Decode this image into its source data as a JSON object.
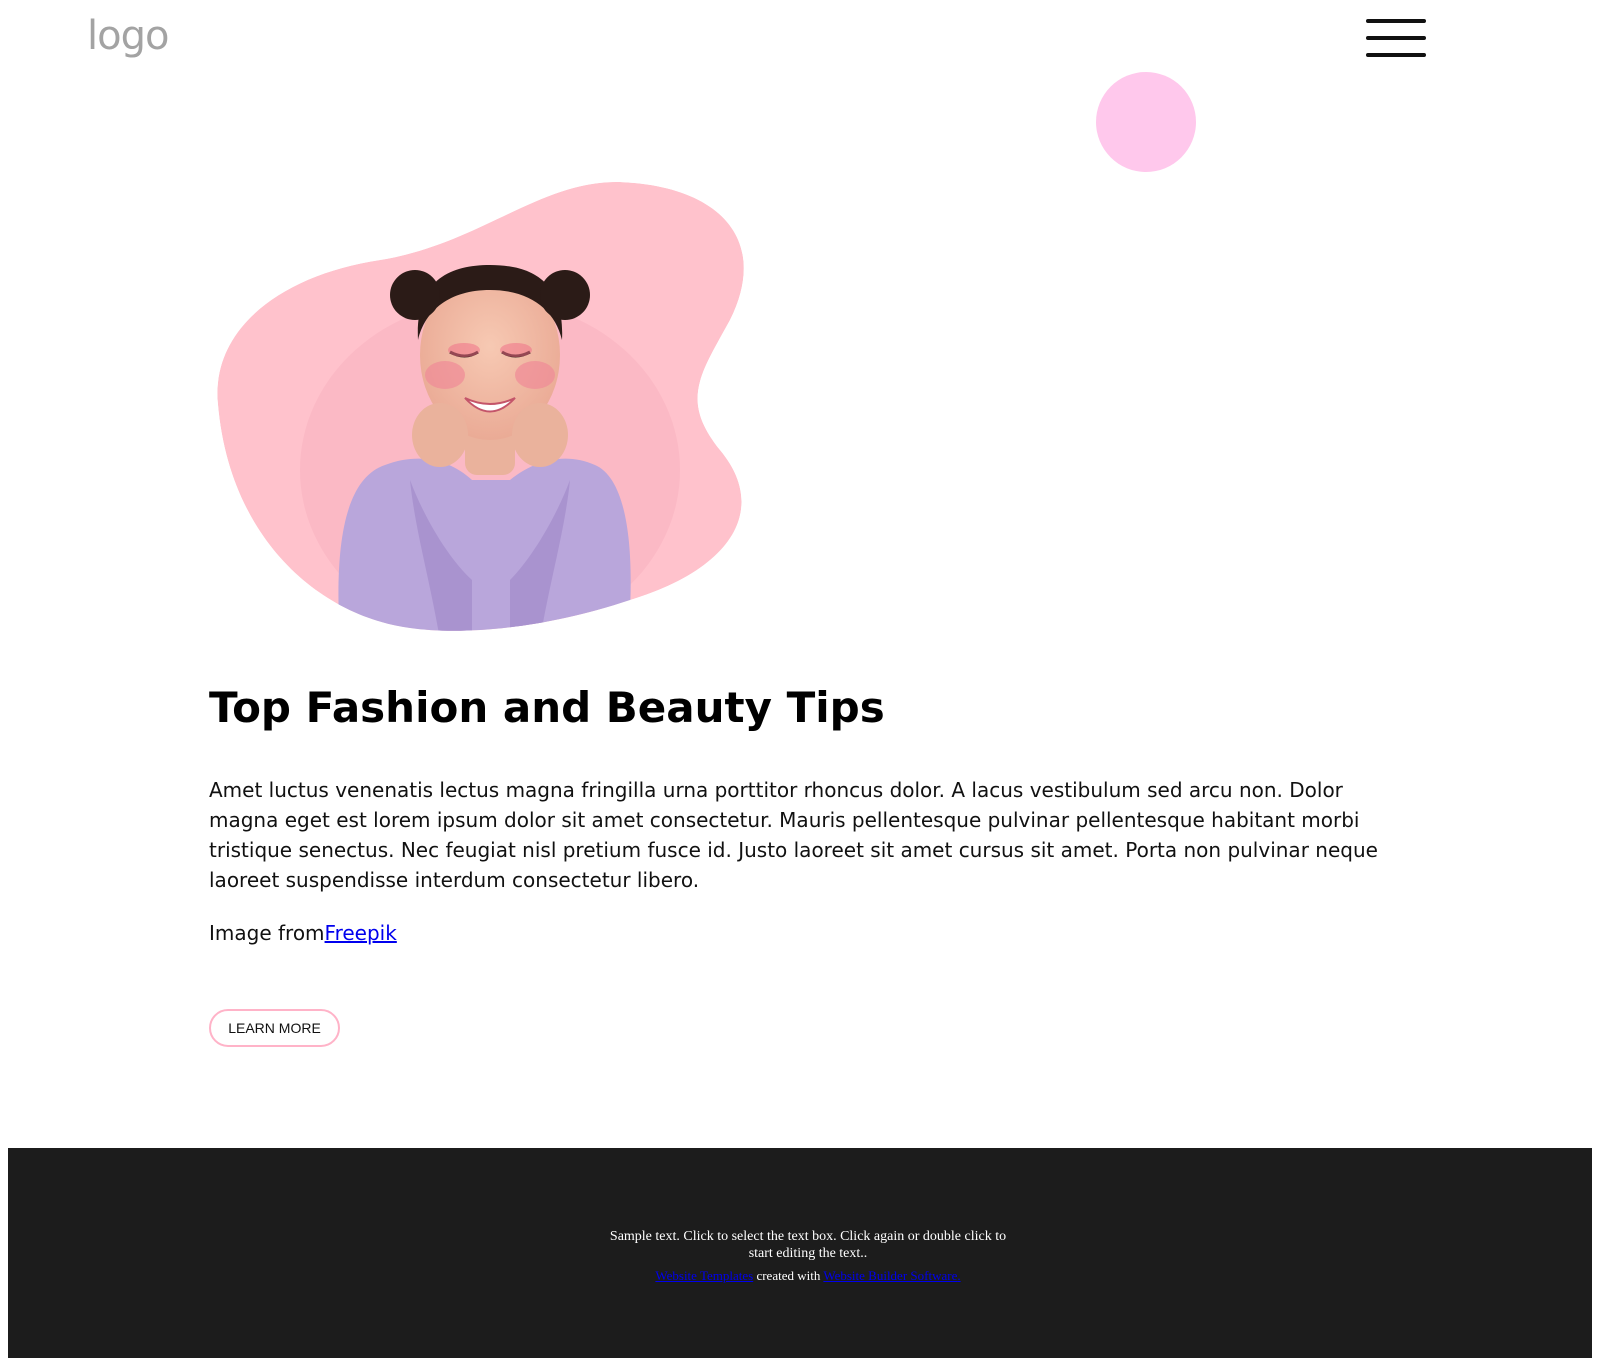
{
  "header": {
    "logo_text": "logo",
    "menu_icon": "hamburger-menu-icon"
  },
  "hero": {
    "image_description_icon": "portrait-photo",
    "blob_color": "#ffc2cc",
    "circle_color": "#ffc8ec"
  },
  "main": {
    "title": "Top Fashion and Beauty Tips",
    "body": "Amet luctus venenatis lectus magna fringilla urna porttitor rhoncus dolor. A lacus vestibulum sed arcu non. Dolor magna eget est lorem ipsum dolor sit amet consectetur. Mauris pellentesque pulvinar pellentesque habitant morbi tristique senectus. Nec feugiat nisl pretium fusce id. Justo laoreet sit amet cursus sit amet. Porta non pulvinar neque laoreet suspendisse interdum consectetur libero.",
    "credit_prefix": "Image from",
    "credit_link": "Freepik",
    "button_label": "LEARN MORE",
    "button_border_color": "#ffb3c8"
  },
  "footer": {
    "sample_text": "Sample text. Click to select the text box. Click again or double click to start editing the text..",
    "link1": "Website Templates",
    "middle": " created with ",
    "link2": "Website Builder Software",
    "link2_suffix": ".",
    "background": "#1c1c1c"
  }
}
